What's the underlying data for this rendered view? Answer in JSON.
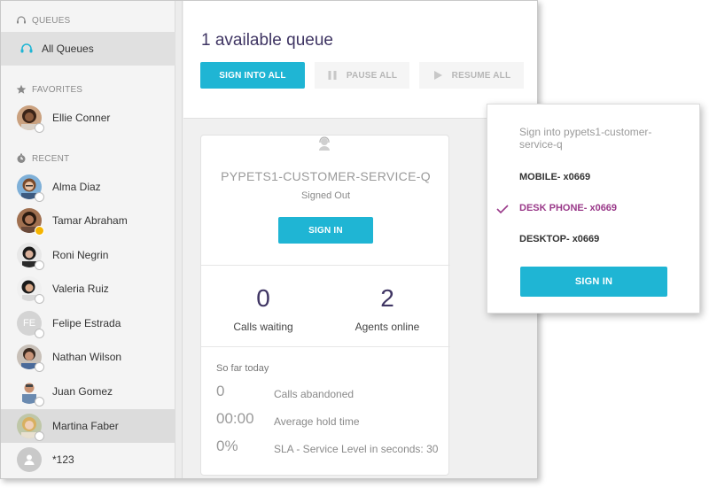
{
  "sidebar": {
    "queues_header": "QUEUES",
    "queue_item": "All Queues",
    "favorites_header": "FAVORITES",
    "favorites": [
      {
        "name": "Ellie Conner",
        "status": "offline",
        "avatar": "photo"
      }
    ],
    "recent_header": "RECENT",
    "recent": [
      {
        "name": "Alma Diaz",
        "status": "offline",
        "avatar": "photo"
      },
      {
        "name": "Tamar Abraham",
        "status": "away",
        "avatar": "photo"
      },
      {
        "name": "Roni Negrin",
        "status": "offline",
        "avatar": "photo"
      },
      {
        "name": "Valeria Ruiz",
        "status": "offline",
        "avatar": "photo"
      },
      {
        "name": "Felipe Estrada",
        "status": "offline",
        "avatar": "initials",
        "initials": "FE"
      },
      {
        "name": "Nathan Wilson",
        "status": "offline",
        "avatar": "photo"
      },
      {
        "name": "Juan Gomez",
        "status": "offline",
        "avatar": "photo"
      },
      {
        "name": "Martina Faber",
        "status": "offline",
        "avatar": "photo",
        "selected": true
      },
      {
        "name": "*123",
        "status": "none",
        "avatar": "generic"
      }
    ]
  },
  "main": {
    "title": "1 available queue",
    "buttons": {
      "sign_into_all": "SIGN INTO ALL",
      "pause_all": "PAUSE ALL",
      "resume_all": "RESUME ALL"
    },
    "card": {
      "queue_name": "PYPETS1-CUSTOMER-SERVICE-Q",
      "status": "Signed Out",
      "sign_in": "SIGN IN",
      "calls_waiting_value": "0",
      "calls_waiting_label": "Calls waiting",
      "agents_online_value": "2",
      "agents_online_label": "Agents online",
      "today_title": "So far today",
      "today": [
        {
          "value": "0",
          "label": "Calls abandoned"
        },
        {
          "value": "00:00",
          "label": "Average hold time"
        },
        {
          "value": "0%",
          "label": "SLA - Service Level in seconds: 30"
        }
      ]
    }
  },
  "popup": {
    "title": "Sign into pypets1-customer-service-q",
    "options": [
      {
        "label": "MOBILE- x0669",
        "selected": false
      },
      {
        "label": "DESK PHONE- x0669",
        "selected": true
      },
      {
        "label": "DESKTOP- x0669",
        "selected": false
      }
    ],
    "sign_in": "SIGN IN"
  },
  "colors": {
    "accent": "#1fb5d4",
    "title": "#3f3563",
    "selected_option": "#9a3a8a",
    "away": "#f5b400"
  }
}
